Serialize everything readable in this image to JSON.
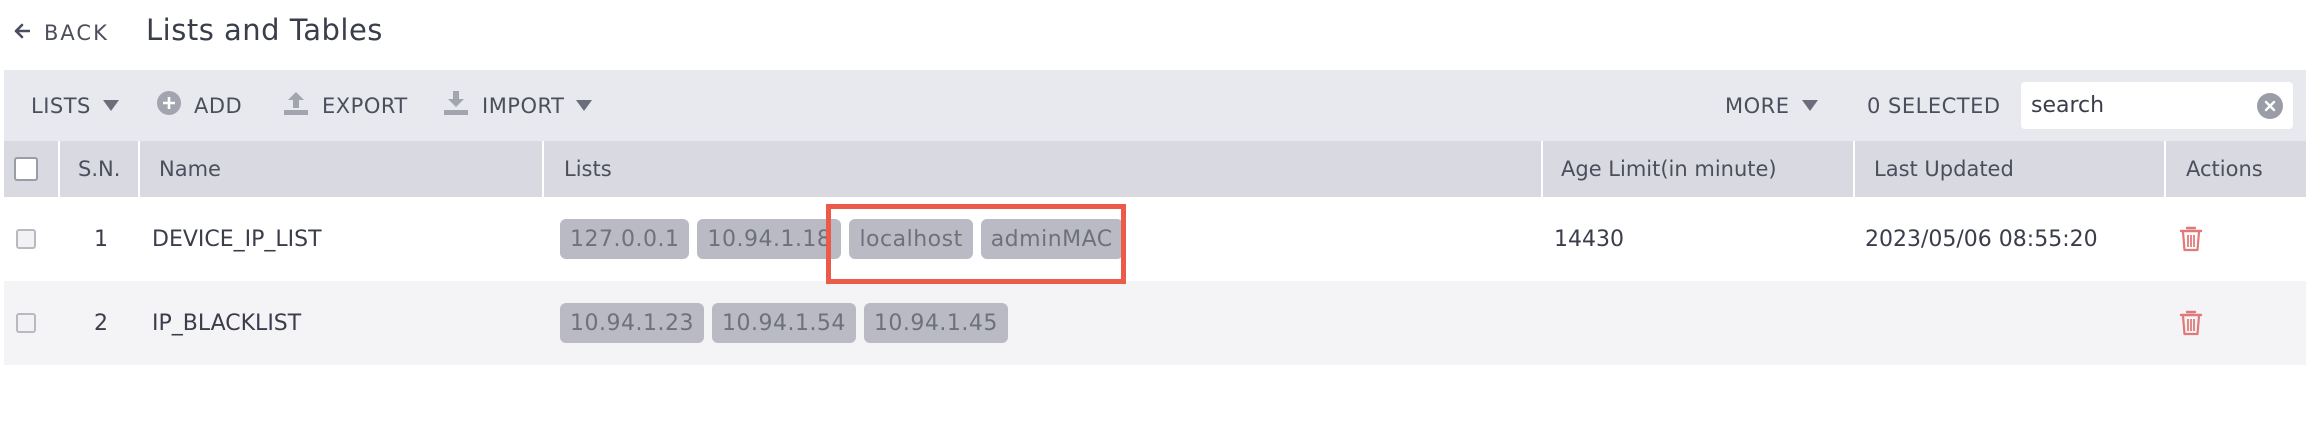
{
  "header": {
    "back_label": "BACK",
    "title": "Lists and Tables"
  },
  "toolbar": {
    "lists_label": "LISTS",
    "add_label": "ADD",
    "export_label": "EXPORT",
    "import_label": "IMPORT",
    "more_label": "MORE",
    "selected_label": "0 SELECTED",
    "search_placeholder": "search"
  },
  "table": {
    "columns": {
      "sn": "S.N.",
      "name": "Name",
      "lists": "Lists",
      "age": "Age Limit(in minute)",
      "updated": "Last Updated",
      "actions": "Actions"
    },
    "rows": [
      {
        "sn": "1",
        "name": "DEVICE_IP_LIST",
        "tags": [
          "127.0.0.1",
          "10.94.1.18",
          "localhost",
          "adminMAC"
        ],
        "age": "14430",
        "updated": "2023/05/06 08:55:20"
      },
      {
        "sn": "2",
        "name": "IP_BLACKLIST",
        "tags": [
          "10.94.1.23",
          "10.94.1.54",
          "10.94.1.45"
        ],
        "age": "",
        "updated": ""
      }
    ]
  },
  "colors": {
    "toolbar_bg": "#e8e9ee",
    "header_bg": "#d9dae1",
    "tag_bg": "#b9bac4",
    "highlight": "#ec5a4a",
    "trash": "#e07a7a"
  },
  "icons": [
    "arrow-left-icon",
    "caret-down-icon",
    "plus-circle-icon",
    "upload-icon",
    "download-icon",
    "clear-icon",
    "trash-icon"
  ]
}
